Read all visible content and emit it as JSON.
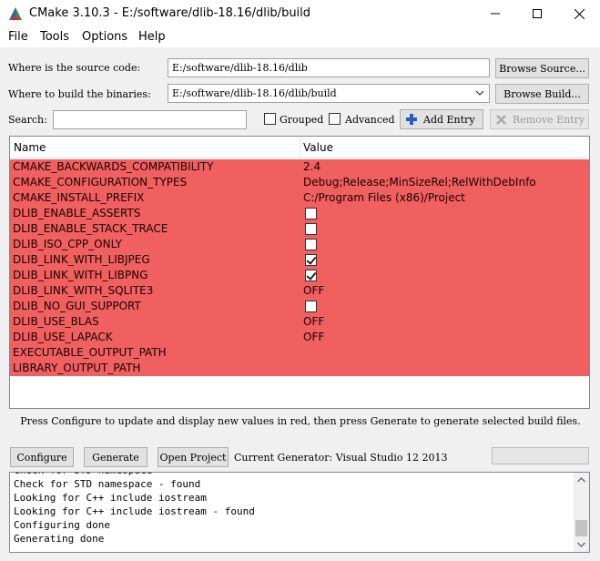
{
  "window": {
    "title": "CMake 3.10.3 - E:/software/dlib-18.16/dlib/build"
  },
  "menu": [
    "File",
    "Tools",
    "Options",
    "Help"
  ],
  "source": {
    "label": "Where is the source code:",
    "value": "E:/software/dlib-18.16/dlib",
    "browse": "Browse Source..."
  },
  "build": {
    "label": "Where to build the binaries:",
    "value": "E:/software/dlib-18.16/dlib/build",
    "browse": "Browse Build..."
  },
  "search": {
    "label": "Search:",
    "value": ""
  },
  "options": {
    "grouped": "Grouped",
    "advanced": "Advanced",
    "add_entry": "Add Entry",
    "remove_entry": "Remove Entry"
  },
  "table": {
    "headers": {
      "name": "Name",
      "value": "Value"
    },
    "rows": [
      {
        "name": "CMAKE_BACKWARDS_COMPATIBILITY",
        "value": "2.4"
      },
      {
        "name": "CMAKE_CONFIGURATION_TYPES",
        "value": "Debug;Release;MinSizeRel;RelWithDebInfo"
      },
      {
        "name": "CMAKE_INSTALL_PREFIX",
        "value": "C:/Program Files (x86)/Project"
      },
      {
        "name": "DLIB_ENABLE_ASSERTS",
        "checkbox": false
      },
      {
        "name": "DLIB_ENABLE_STACK_TRACE",
        "checkbox": false
      },
      {
        "name": "DLIB_ISO_CPP_ONLY",
        "checkbox": false
      },
      {
        "name": "DLIB_LINK_WITH_LIBJPEG",
        "checkbox": true
      },
      {
        "name": "DLIB_LINK_WITH_LIBPNG",
        "checkbox": true
      },
      {
        "name": "DLIB_LINK_WITH_SQLITE3",
        "value": "OFF"
      },
      {
        "name": "DLIB_NO_GUI_SUPPORT",
        "checkbox": false
      },
      {
        "name": "DLIB_USE_BLAS",
        "value": "OFF"
      },
      {
        "name": "DLIB_USE_LAPACK",
        "value": "OFF"
      },
      {
        "name": "EXECUTABLE_OUTPUT_PATH",
        "value": ""
      },
      {
        "name": "LIBRARY_OUTPUT_PATH",
        "value": ""
      }
    ],
    "row_color": "#f06060"
  },
  "hint": "Press Configure to update and display new values in red, then press Generate to generate selected build files.",
  "actions": {
    "configure": "Configure",
    "generate": "Generate",
    "open_project": "Open Project",
    "generator": "Current Generator: Visual Studio 12 2013"
  },
  "log": [
    "Check for STD namespace",
    "Check for STD namespace - found",
    "Looking for C++ include iostream",
    "Looking for C++ include iostream - found",
    "Configuring done",
    "Generating done"
  ]
}
